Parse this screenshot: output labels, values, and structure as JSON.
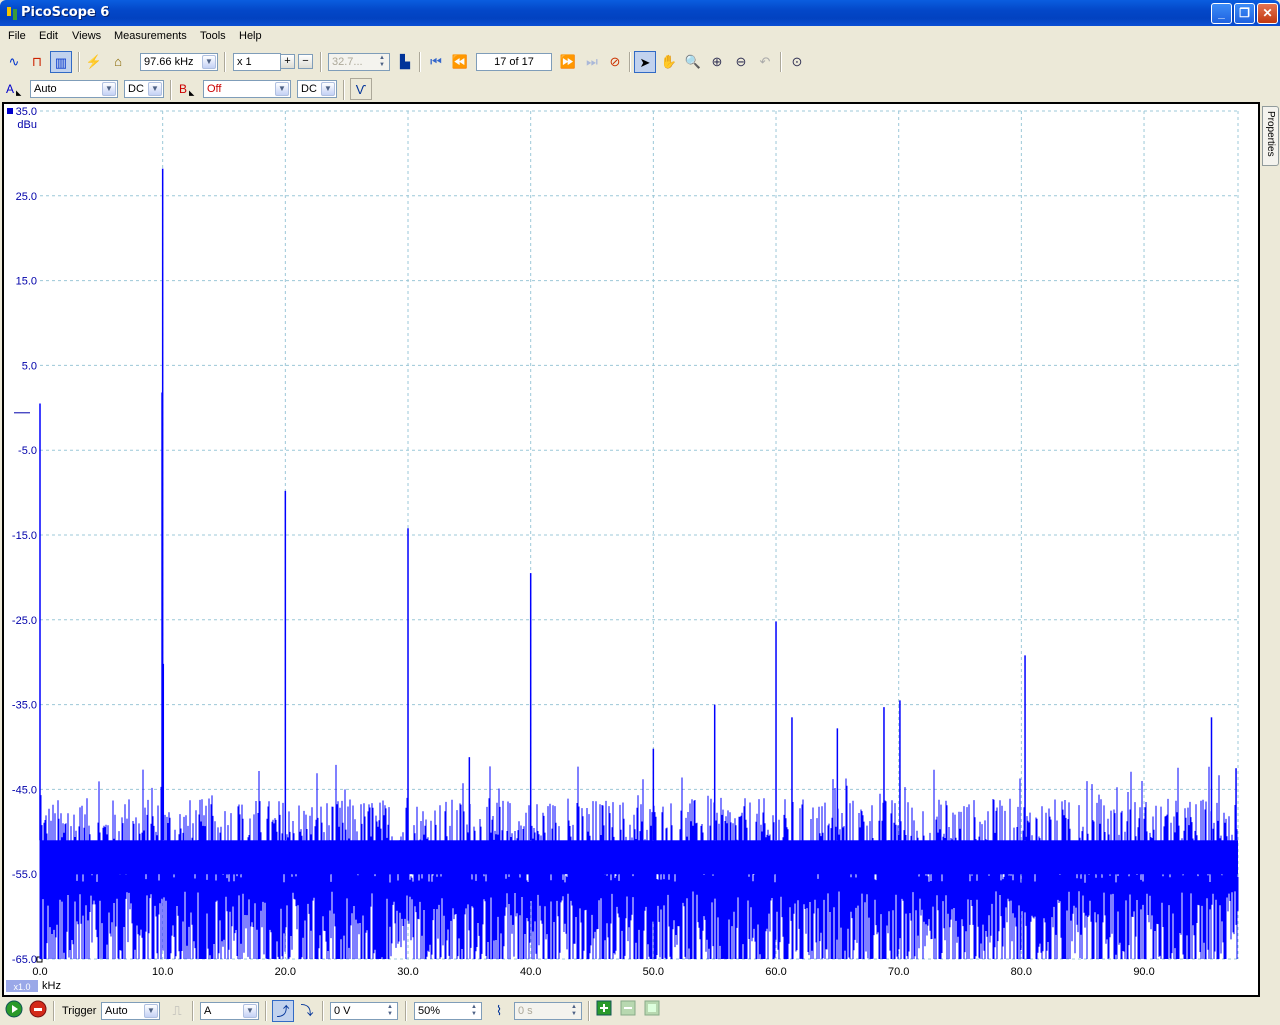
{
  "window": {
    "title": "PicoScope 6"
  },
  "menu": {
    "items": [
      "File",
      "Edit",
      "Views",
      "Measurements",
      "Tools",
      "Help"
    ]
  },
  "toolbar": {
    "span_value": "97.66 kHz",
    "zoom_value": "x 1",
    "points_value": "32.7...",
    "page_counter": "17 of 17"
  },
  "channels": {
    "a": {
      "label": "A",
      "range": "Auto",
      "coupling": "DC"
    },
    "b": {
      "label": "B",
      "range": "Off",
      "coupling": "DC"
    }
  },
  "trigger": {
    "label": "Trigger",
    "mode": "Auto",
    "source": "A",
    "level": "0 V",
    "position": "50%",
    "delay": "0 s"
  },
  "side_tab": {
    "label": "Properties"
  },
  "colors": {
    "trace": "#0000ff",
    "grid": "#9cc8d8",
    "frame": "#000000"
  },
  "chart_data": {
    "type": "line",
    "title": "",
    "ylabel": "dBu",
    "xlabel": "kHz",
    "scale_badge": "x1.0",
    "xlim": [
      0,
      97.66
    ],
    "ylim": [
      -65,
      35
    ],
    "xticks": [
      "0.0",
      "10.0",
      "20.0",
      "30.0",
      "40.0",
      "50.0",
      "60.0",
      "70.0",
      "80.0",
      "90.0"
    ],
    "yticks": [
      "35.0",
      "25.0",
      "15.0",
      "5.0",
      "-5.0",
      "-15.0",
      "-25.0",
      "-35.0",
      "-45.0",
      "-55.0",
      "-65.0"
    ],
    "noise_floor": {
      "low": -65,
      "high": -48
    },
    "peaks": [
      {
        "x": 0.0,
        "y": 0.5
      },
      {
        "x": 10.0,
        "y": 28.2
      },
      {
        "x": 9.95,
        "y": 1.8
      },
      {
        "x": 10.05,
        "y": -30.2
      },
      {
        "x": 20.0,
        "y": -9.8
      },
      {
        "x": 30.0,
        "y": -14.2
      },
      {
        "x": 35.0,
        "y": -41.2
      },
      {
        "x": 40.0,
        "y": -19.5
      },
      {
        "x": 50.0,
        "y": -40.2
      },
      {
        "x": 55.0,
        "y": -35.0
      },
      {
        "x": 60.0,
        "y": -25.2
      },
      {
        "x": 61.3,
        "y": -36.5
      },
      {
        "x": 65.0,
        "y": -37.8
      },
      {
        "x": 68.8,
        "y": -35.3
      },
      {
        "x": 70.1,
        "y": -34.5
      },
      {
        "x": 80.3,
        "y": -29.2
      },
      {
        "x": 95.5,
        "y": -36.5
      },
      {
        "x": 97.5,
        "y": -42.5
      }
    ]
  }
}
